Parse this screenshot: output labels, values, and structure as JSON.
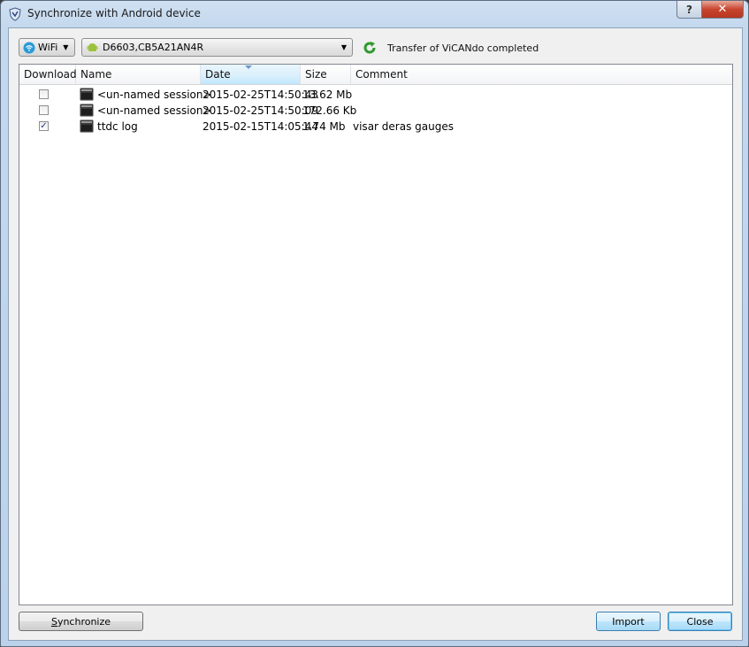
{
  "window": {
    "title": "Synchronize with Android device",
    "help_label": "?",
    "close_label": "✕"
  },
  "toolbar": {
    "connection_label": "WiFi",
    "device_selected": "D6603,CB5A21AN4R",
    "status": "Transfer of ViCANdo completed"
  },
  "table": {
    "columns": [
      "Download",
      "Name",
      "Date",
      "Size",
      "Comment"
    ],
    "sorted_column": "Date",
    "rows": [
      {
        "checked": false,
        "name": "<un-named session>",
        "date": "2015-02-25T14:50:43",
        "size": "13.62 Mb",
        "comment": ""
      },
      {
        "checked": false,
        "name": "<un-named session>",
        "date": "2015-02-25T14:50:09",
        "size": "172.66 Kb",
        "comment": ""
      },
      {
        "checked": true,
        "name": "ttdc log",
        "date": "2015-02-15T14:05:44",
        "size": "1.74 Mb",
        "comment": "visar deras gauges"
      }
    ]
  },
  "footer": {
    "synchronize_mnemonic": "S",
    "synchronize_rest": "ynchronize",
    "import_label": "Import",
    "close_label": "Close"
  },
  "colors": {
    "accent": "#3c7fb1",
    "status_icon": "#2e9a2e",
    "android": "#9bc23c"
  }
}
